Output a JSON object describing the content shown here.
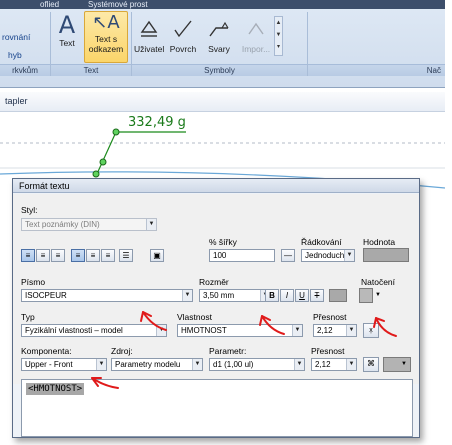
{
  "ribbon": {
    "top_labels": [
      "oflied",
      "Systémové prost"
    ],
    "left_labels": [
      "rovnání",
      "hyb",
      "rkvkům"
    ],
    "text_btn": "Text",
    "leader_text_btn": [
      "Text s",
      "odkazem"
    ],
    "symbols": [
      "Uživatel",
      "Povrch",
      "Svary",
      "Impor..."
    ],
    "group_text": "Text",
    "group_symbols": "Symboly",
    "group_next": "Nač"
  },
  "browser": {
    "title": "tapler"
  },
  "drawing": {
    "leader_value": "332,49 g"
  },
  "dialog": {
    "title": "Formát textu",
    "style_label": "Styl:",
    "style_value": "Text poznámky (DIN)",
    "width_pct_label": "% šířky",
    "width_pct_value": "100",
    "line_spacing_label": "Řádkování",
    "line_spacing_value": "Jednoduchý",
    "value_label": "Hodnota",
    "font_label": "Písmo",
    "font_value": "ISOCPEUR",
    "size_label": "Rozměr",
    "size_value": "3,50 mm",
    "bold": "B",
    "italic": "I",
    "underline": "U",
    "strike": "T",
    "rotation_label": "Natočení",
    "type_label": "Typ",
    "type_value": "Fyzikální vlastnosti – model",
    "property_label": "Vlastnost",
    "property_value": "HMOTNOST",
    "precision_label": "Přesnost",
    "precision_value": "2,12",
    "component_label": "Komponenta:",
    "component_value": "Upper - Front",
    "source_label": "Zdroj:",
    "source_value": "Parametry modelu",
    "param_label": "Parametr:",
    "param_value": "d1 (1,00 ul)",
    "precision2_label": "Přesnost",
    "precision2_value": "2,12",
    "text_content": "<HMOTNOST>"
  }
}
